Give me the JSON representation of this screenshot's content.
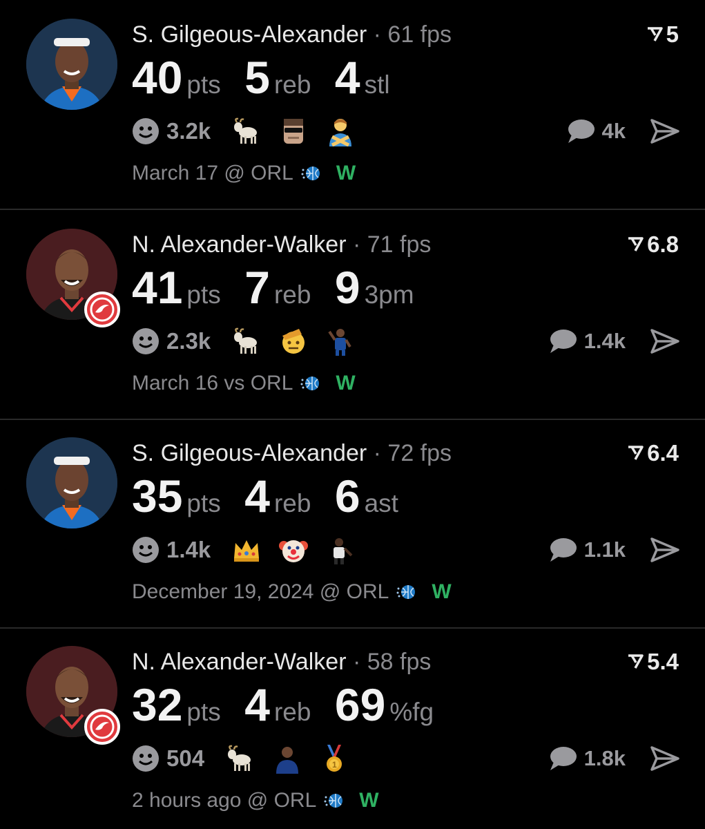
{
  "posts": [
    {
      "player": "S. Gilgeous-Alexander",
      "separator": "·",
      "fps": "61 fps",
      "rating": "5",
      "team": "thunder",
      "stats": [
        {
          "value": "40",
          "unit": "pts"
        },
        {
          "value": "5",
          "unit": "reb"
        },
        {
          "value": "4",
          "unit": "stl"
        }
      ],
      "reaction_count": "3.2k",
      "emojis": [
        "goat-icon",
        "luka-sunglasses-icon",
        "person-crossed-arms-icon"
      ],
      "comment_count": "4k",
      "date_opponent": "March 17 @ ORL",
      "result": "W"
    },
    {
      "player": "N. Alexander-Walker",
      "separator": "·",
      "fps": "71 fps",
      "rating": "6.8",
      "team": "hawks",
      "stats": [
        {
          "value": "41",
          "unit": "pts"
        },
        {
          "value": "7",
          "unit": "reb"
        },
        {
          "value": "9",
          "unit": "3pm"
        }
      ],
      "reaction_count": "2.3k",
      "emojis": [
        "goat-icon",
        "saluting-face-icon",
        "player-celebration-icon"
      ],
      "comment_count": "1.4k",
      "date_opponent": "March 16 vs ORL",
      "result": "W"
    },
    {
      "player": "S. Gilgeous-Alexander",
      "separator": "·",
      "fps": "72 fps",
      "rating": "6.4",
      "team": "thunder",
      "stats": [
        {
          "value": "35",
          "unit": "pts"
        },
        {
          "value": "4",
          "unit": "reb"
        },
        {
          "value": "6",
          "unit": "ast"
        }
      ],
      "reaction_count": "1.4k",
      "emojis": [
        "crown-icon",
        "clown-face-icon",
        "player-pose-icon"
      ],
      "comment_count": "1.1k",
      "date_opponent": "December 19, 2024 @ ORL",
      "result": "W"
    },
    {
      "player": "N. Alexander-Walker",
      "separator": "·",
      "fps": "58 fps",
      "rating": "5.4",
      "team": "hawks",
      "stats": [
        {
          "value": "32",
          "unit": "pts"
        },
        {
          "value": "4",
          "unit": "reb"
        },
        {
          "value": "69",
          "unit": "%fg"
        }
      ],
      "reaction_count": "504",
      "emojis": [
        "goat-icon",
        "player-portrait-icon",
        "gold-medal-icon"
      ],
      "comment_count": "1.8k",
      "date_opponent": "2 hours ago @ ORL",
      "result": "W"
    }
  ],
  "colors": {
    "background": "#000000",
    "win_green": "#2fb162",
    "muted_text": "#8a8a8e",
    "hawks_red": "#e03a3e",
    "thunder_blue": "#1d3550"
  }
}
